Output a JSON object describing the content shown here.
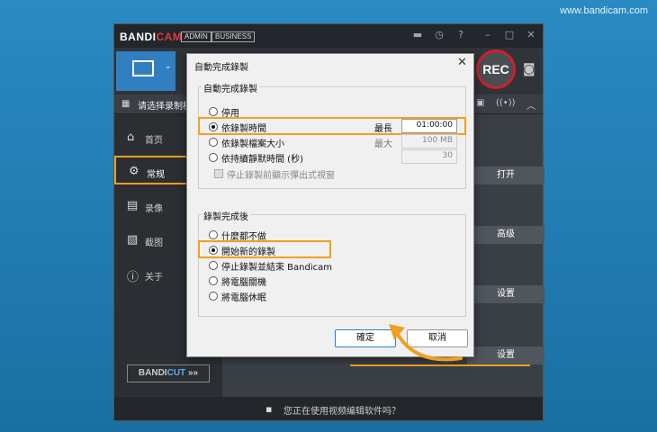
{
  "watermark": "www.bandicam.com",
  "app": {
    "logo_main": "BANDI",
    "logo_cam": "CAM",
    "badge_admin": "ADMIN",
    "badge_business": "BUSINESS",
    "rec_label": "REC",
    "subbar_label": "请选择录制模",
    "nav": [
      {
        "label": "首页"
      },
      {
        "label": "常规"
      },
      {
        "label": "录像"
      },
      {
        "label": "截图"
      },
      {
        "label": "关于"
      }
    ],
    "bandicut_main": "BANDI",
    "bandicut_cut": "CUT",
    "bandicut_arrow": "»»",
    "right_buttons": {
      "open": "打开",
      "advanced": "高级",
      "settings1": "设置",
      "settings2": "设置"
    },
    "status_text": "您正在使用视频编辑软件吗？"
  },
  "dialog": {
    "title": "自動完成錄製",
    "close": "✕",
    "group1_title": "自動完成錄製",
    "options1": [
      {
        "label": "停用"
      },
      {
        "label": "依錄製時間"
      },
      {
        "label": "依錄製檔案大小"
      },
      {
        "label": "依持續靜默時間 (秒)"
      }
    ],
    "selected1": 1,
    "max_label": "最長",
    "max_label2": "最大",
    "time_value": "01:00:00",
    "size_value": "100 MB",
    "silence_value": "30",
    "checkbox_label": "停止錄製前顯示彈出式視窗",
    "group2_title": "錄製完成後",
    "options2": [
      {
        "label": "什麼都不做"
      },
      {
        "label": "開始新的錄製"
      },
      {
        "label": "停止錄製並結束 Bandicam"
      },
      {
        "label": "將電腦關機"
      },
      {
        "label": "將電腦休眠"
      }
    ],
    "selected2": 1,
    "ok_label": "確定",
    "cancel_label": "取消"
  },
  "colors": {
    "highlight": "#f0a020",
    "rec_ring": "#d21f2b",
    "accent": "#2f7fc1"
  }
}
